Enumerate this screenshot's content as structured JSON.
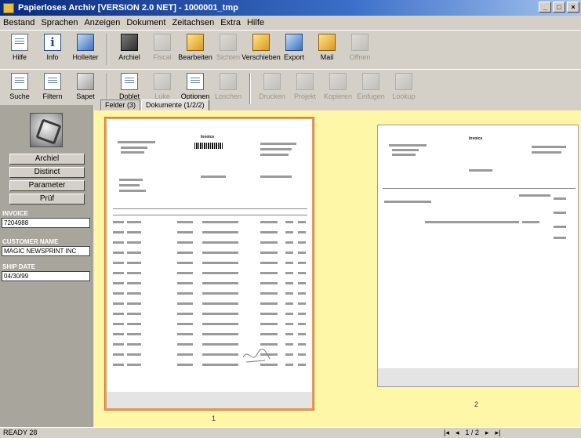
{
  "window": {
    "title": "Papierloses Archiv [VERSION 2.0 NET] - 1000001_tmp"
  },
  "menu": [
    "Bestand",
    "Sprachen",
    "Anzeigen",
    "Dokument",
    "Zeitachsen",
    "Extra",
    "Hilfe"
  ],
  "toolbar1": [
    {
      "label": "Hilfe",
      "icon": "help-icon",
      "style": "ico-doc",
      "enabled": true
    },
    {
      "label": "Info",
      "icon": "info-icon",
      "style": "ico-info",
      "enabled": true
    },
    {
      "label": "Holleiter",
      "icon": "book-icon",
      "style": "ico-blue",
      "enabled": true
    },
    {
      "sep": true
    },
    {
      "label": "Archiel",
      "icon": "archive-icon",
      "style": "ico-dark",
      "enabled": true
    },
    {
      "label": "Fiscal",
      "icon": "fiscal-icon",
      "style": "ico-grey",
      "enabled": false
    },
    {
      "label": "Bearbeiten",
      "icon": "folder-icon",
      "style": "ico-gold",
      "enabled": true
    },
    {
      "label": "Sichten",
      "icon": "view-icon",
      "style": "ico-grey",
      "enabled": false
    },
    {
      "label": "Verschieben",
      "icon": "move-icon",
      "style": "ico-gold",
      "enabled": true
    },
    {
      "label": "Export",
      "icon": "export-icon",
      "style": "ico-blue",
      "enabled": true
    },
    {
      "label": "Mail",
      "icon": "mail-icon",
      "style": "ico-gold",
      "enabled": true
    },
    {
      "label": "Offnen",
      "icon": "open-icon",
      "style": "ico-grey",
      "enabled": false
    }
  ],
  "toolbar2": [
    {
      "label": "Suche",
      "icon": "search-icon",
      "style": "ico-doc",
      "enabled": true
    },
    {
      "label": "Filtern",
      "icon": "filter-icon",
      "style": "ico-doc",
      "enabled": true
    },
    {
      "label": "Sapet",
      "icon": "save-icon",
      "style": "ico-grey",
      "enabled": true
    },
    {
      "sep": true
    },
    {
      "label": "Doblet",
      "icon": "double-icon",
      "style": "ico-doc",
      "enabled": true
    },
    {
      "label": "Luke",
      "icon": "layout-icon",
      "style": "ico-grey",
      "enabled": false
    },
    {
      "label": "Optionen",
      "icon": "options-icon",
      "style": "ico-doc",
      "enabled": true
    },
    {
      "label": "Loschen",
      "icon": "delete-icon",
      "style": "ico-grey",
      "enabled": false
    },
    {
      "sep": true
    },
    {
      "label": "Drucken",
      "icon": "print-icon",
      "style": "ico-grey",
      "enabled": false
    },
    {
      "label": "Projekt",
      "icon": "project-icon",
      "style": "ico-grey",
      "enabled": false
    },
    {
      "label": "Kopieren",
      "icon": "copy-icon",
      "style": "ico-grey",
      "enabled": false
    },
    {
      "label": "Einfugen",
      "icon": "paste-icon",
      "style": "ico-grey",
      "enabled": false
    },
    {
      "label": "Lookup",
      "icon": "lookup-icon",
      "style": "ico-grey",
      "enabled": false
    }
  ],
  "left": {
    "buttons": [
      "Archiel",
      "Distinct",
      "Parameter",
      "Prüf"
    ],
    "fields": [
      {
        "label": "INVOICE",
        "value": "7204988"
      },
      {
        "label": "CUSTOMER NAME",
        "value": "MAGIC NEWSPRINT INC"
      },
      {
        "label": "SHIP DATE",
        "value": "04/30/99"
      }
    ]
  },
  "tabs": [
    "Felder (3)",
    "Dokumente (1/2/2)"
  ],
  "pages": [
    "1",
    "2"
  ],
  "doc": {
    "title": "Invoice"
  },
  "status": {
    "left": "READY   28",
    "nav": [
      "|◂",
      "◂",
      "1 / 2",
      "▸",
      "▸|"
    ]
  }
}
